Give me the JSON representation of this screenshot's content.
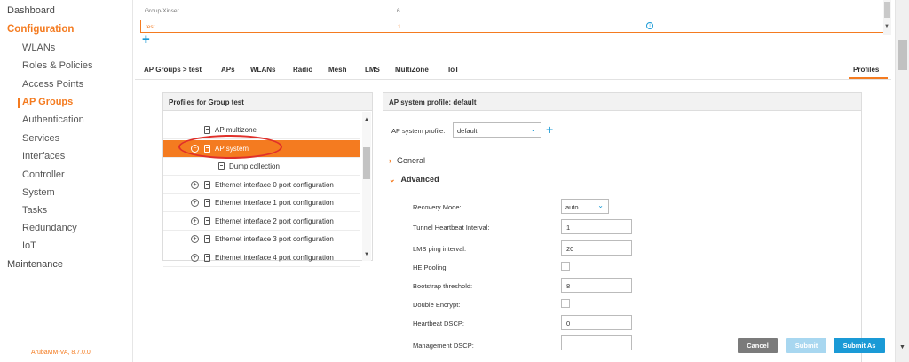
{
  "sidebar": {
    "items": [
      {
        "label": "Dashboard",
        "type": "top",
        "active": false
      },
      {
        "label": "Configuration",
        "type": "section",
        "active": false
      },
      {
        "label": "WLANs",
        "type": "sub",
        "active": false
      },
      {
        "label": "Roles & Policies",
        "type": "sub",
        "active": false
      },
      {
        "label": "Access Points",
        "type": "sub",
        "active": false
      },
      {
        "label": "AP Groups",
        "type": "sub",
        "active": true
      },
      {
        "label": "Authentication",
        "type": "sub",
        "active": false
      },
      {
        "label": "Services",
        "type": "sub",
        "active": false
      },
      {
        "label": "Interfaces",
        "type": "sub",
        "active": false
      },
      {
        "label": "Controller",
        "type": "sub",
        "active": false
      },
      {
        "label": "System",
        "type": "sub",
        "active": false
      },
      {
        "label": "Tasks",
        "type": "sub",
        "active": false
      },
      {
        "label": "Redundancy",
        "type": "sub",
        "active": false
      },
      {
        "label": "IoT",
        "type": "sub",
        "active": false
      },
      {
        "label": "Maintenance",
        "type": "top",
        "active": false
      }
    ],
    "version": "ArubaMM-VA, 8.7.0.0"
  },
  "group_table": {
    "rows": [
      {
        "name": "Group-Xinser",
        "count": "6"
      },
      {
        "name": "test",
        "count": "1"
      }
    ]
  },
  "tabs": {
    "breadcrumb": "AP Groups > test",
    "items": [
      "APs",
      "WLANs",
      "Radio",
      "Mesh",
      "LMS",
      "MultiZone",
      "IoT"
    ],
    "profiles": "Profiles"
  },
  "profiles_panel": {
    "title": "Profiles for Group test",
    "items": [
      {
        "label": "AP multizone",
        "selected": false,
        "expander": "",
        "indent": 0
      },
      {
        "label": "AP system",
        "selected": true,
        "expander": "−",
        "indent": 0
      },
      {
        "label": "Dump collection",
        "selected": false,
        "expander": "",
        "indent": 1
      },
      {
        "label": "Ethernet interface 0 port configuration",
        "selected": false,
        "expander": "+",
        "indent": 0
      },
      {
        "label": "Ethernet interface 1 port configuration",
        "selected": false,
        "expander": "+",
        "indent": 0
      },
      {
        "label": "Ethernet interface 2 port configuration",
        "selected": false,
        "expander": "+",
        "indent": 0
      },
      {
        "label": "Ethernet interface 3 port configuration",
        "selected": false,
        "expander": "+",
        "indent": 0
      },
      {
        "label": "Ethernet interface 4 port configuration",
        "selected": false,
        "expander": "+",
        "indent": 0
      }
    ]
  },
  "detail": {
    "title": "AP system profile: default",
    "profile_label": "AP system profile:",
    "profile_value": "default",
    "general": "General",
    "advanced": "Advanced",
    "fields": {
      "recovery_mode": {
        "label": "Recovery Mode:",
        "value": "auto"
      },
      "tunnel_heartbeat": {
        "label": "Tunnel Heartbeat Interval:",
        "value": "1"
      },
      "lms_ping": {
        "label": "LMS ping interval:",
        "value": "20"
      },
      "he_pooling": {
        "label": "HE Pooling:"
      },
      "bootstrap": {
        "label": "Bootstrap threshold:",
        "value": "8"
      },
      "double_encrypt": {
        "label": "Double Encrypt:"
      },
      "heartbeat_dscp": {
        "label": "Heartbeat DSCP:",
        "value": "0"
      },
      "management_dscp": {
        "label": "Management DSCP:",
        "value": ""
      }
    }
  },
  "actions": {
    "cancel": "Cancel",
    "submit": "Submit",
    "submit_as": "Submit As"
  },
  "colors": {
    "accent": "#f47b20",
    "link": "#1a9ad6",
    "annotation": "#e0302a"
  }
}
